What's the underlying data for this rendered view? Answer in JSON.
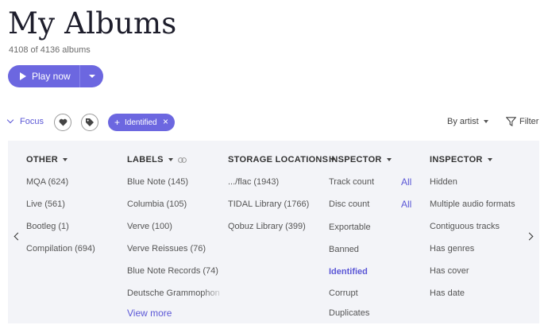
{
  "header": {
    "title": "My Albums",
    "count": "4108 of 4136 albums",
    "play_label": "Play now"
  },
  "toolbar": {
    "focus_label": "Focus",
    "chip_label": "Identified",
    "chip_close": "×",
    "chip_plus": "+",
    "sort_label": "By artist",
    "filter_label": "Filter"
  },
  "columns": {
    "other": {
      "header": "OTHER",
      "items": [
        "MQA (624)",
        "Live (561)",
        "Bootleg (1)",
        "Compilation (694)"
      ]
    },
    "labels": {
      "header": "LABELS",
      "items": [
        "Blue Note (145)",
        "Columbia (105)",
        "Verve (100)",
        "Verve Reissues (76)",
        "Blue Note Records (74)",
        "Deutsche Grammophon"
      ],
      "view_more": "View more"
    },
    "storage": {
      "header": "STORAGE LOCATIONS",
      "items": [
        ".../flac (1943)",
        "TIDAL Library (1766)",
        "Qobuz Library (399)"
      ]
    },
    "inspector1": {
      "header": "INSPECTOR",
      "items": [
        "Track count",
        "Disc count",
        "Exportable",
        "Banned",
        "Identified",
        "Corrupt",
        "Duplicates"
      ],
      "all_links": [
        "All",
        "All"
      ]
    },
    "inspector2": {
      "header": "INSPECTOR",
      "items": [
        "Hidden",
        "Multiple audio formats",
        "Contiguous tracks",
        "Has genres",
        "Has cover",
        "Has date"
      ]
    }
  },
  "colors": {
    "accent": "#6c67e0",
    "link": "#5b57d6",
    "panel_bg": "#f3f4f8"
  },
  "icons": [
    "play-icon",
    "chevron-down-icon",
    "heart-icon",
    "tag-icon",
    "plus-icon",
    "close-icon",
    "filter-icon",
    "link-icon",
    "chevron-left-icon",
    "chevron-right-icon"
  ]
}
